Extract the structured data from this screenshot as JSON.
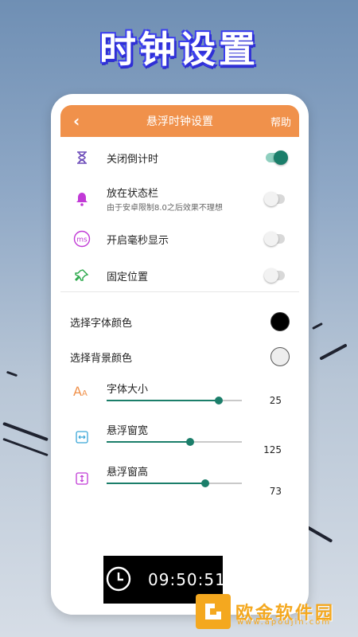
{
  "hero": {
    "title": "时钟设置"
  },
  "appbar": {
    "back": "‹",
    "title": "悬浮时钟设置",
    "help": "帮助"
  },
  "toggles": [
    {
      "label": "关闭倒计时",
      "sub": "",
      "on": true,
      "icon": "hourglass-icon"
    },
    {
      "label": "放在状态栏",
      "sub": "由于安卓限制8.0之后效果不理想",
      "on": false,
      "icon": "bell-icon"
    },
    {
      "label": "开启毫秒显示",
      "sub": "",
      "on": false,
      "icon": "ms-icon"
    },
    {
      "label": "固定位置",
      "sub": "",
      "on": false,
      "icon": "pin-icon"
    }
  ],
  "colors": {
    "font_color_label": "选择字体颜色",
    "font_color": "#000000",
    "bg_color_label": "选择背景颜色",
    "bg_color": "#eeeeee"
  },
  "sliders": [
    {
      "label": "字体大小",
      "value": "25",
      "fraction": 0.83,
      "icon": "font-size-icon"
    },
    {
      "label": "悬浮窗宽",
      "value": "125",
      "fraction": 0.62,
      "icon": "width-icon"
    },
    {
      "label": "悬浮窗高",
      "value": "73",
      "fraction": 0.73,
      "icon": "height-icon"
    }
  ],
  "preview": {
    "time": "09:50:51"
  },
  "brand": {
    "name": "欧金软件园",
    "url": "www.apoujin.com"
  },
  "accent": "#f0914b",
  "switch_on_color": "#1b7e6a"
}
